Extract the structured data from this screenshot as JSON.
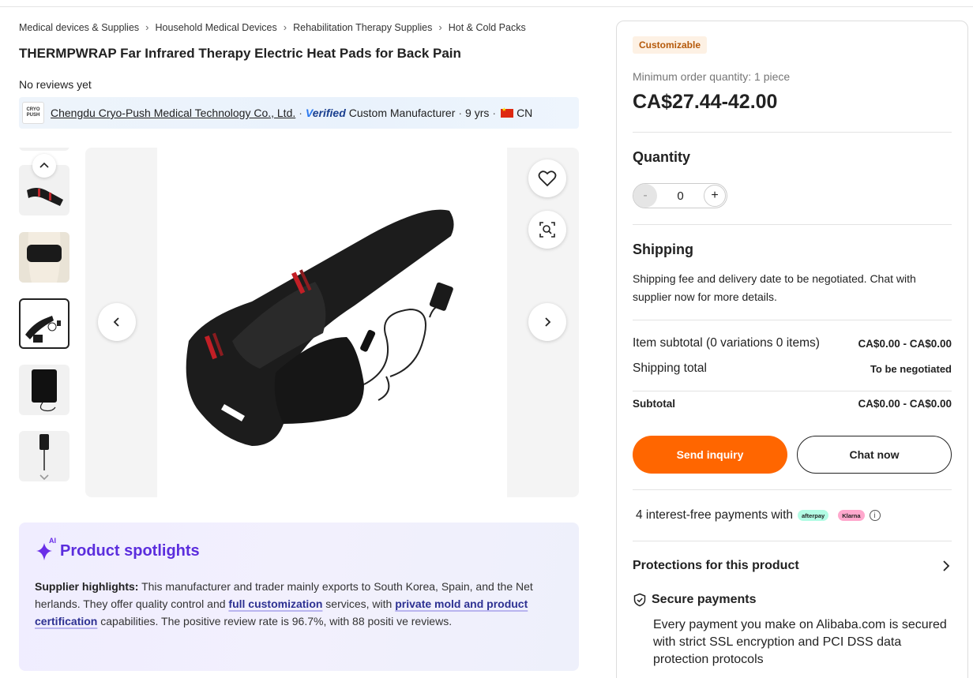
{
  "breadcrumb": [
    "Medical devices & Supplies",
    "Household Medical Devices",
    "Rehabilitation Therapy Supplies",
    "Hot & Cold Packs"
  ],
  "product": {
    "title": "THERMPWRAP Far Infrared Therapy Electric Heat Pads for Back Pain",
    "reviews": "No reviews yet"
  },
  "supplier": {
    "logo_line1": "CRYO",
    "logo_line2": "PUSH",
    "name": "Chengdu Cryo-Push Medical Technology Co., Ltd.",
    "verified_v": "V",
    "verified_rest": "erified",
    "type": "Custom Manufacturer",
    "years": "9 yrs",
    "country": "CN"
  },
  "gallery": {
    "thumb_count": 5,
    "active_index": 2
  },
  "spotlight": {
    "ai_label": "AI",
    "title": "Product spotlights",
    "label": "Supplier highlights:",
    "text1": " This manufacturer and trader mainly exports to South Korea, Spain, and the Net herlands. They offer quality control and ",
    "hl1": "full customization",
    "text2": "  services, with ",
    "hl2": "private mold and product certification",
    "text3": "  capabilities. The positive review rate is 96.7%, with 88 positi ve reviews."
  },
  "order": {
    "badge": "Customizable",
    "moq": "Minimum order quantity: 1 piece",
    "price": "CA$27.44-42.00",
    "quantity_title": "Quantity",
    "quantity_value": "0",
    "minus": "-",
    "plus": "+",
    "shipping_title": "Shipping",
    "shipping_text": "Shipping fee and delivery date to be negotiated. Chat with supplier now for more details.",
    "item_subtotal_label": "Item subtotal (0 variations 0 items)",
    "item_subtotal_value": "CA$0.00 - CA$0.00",
    "shipping_total_label": "Shipping total",
    "shipping_total_value": "To be negotiated",
    "subtotal_label": "Subtotal",
    "subtotal_value": "CA$0.00 - CA$0.00",
    "send_inquiry": "Send inquiry",
    "chat_now": "Chat now",
    "payments_text": "4 interest-free payments with",
    "afterpay": "afterpay",
    "klarna": "Klarna",
    "info": "i",
    "protections_title": "Protections for this product",
    "secure_title": "Secure payments",
    "secure_text": "Every payment you make on Alibaba.com is secured with strict SSL encryption and PCI DSS data protection protocols"
  },
  "colors": {
    "accent_orange": "#ff6600",
    "spotlight_purple": "#5b2ddd",
    "badge_bg": "#fdf1e4",
    "badge_text": "#b5590a"
  },
  "icons": [
    "chevron-right-icon",
    "chevron-up-icon",
    "chevron-down-icon",
    "chevron-left-icon",
    "heart-icon",
    "image-search-icon",
    "sparkle-icon",
    "shield-icon",
    "info-icon"
  ]
}
